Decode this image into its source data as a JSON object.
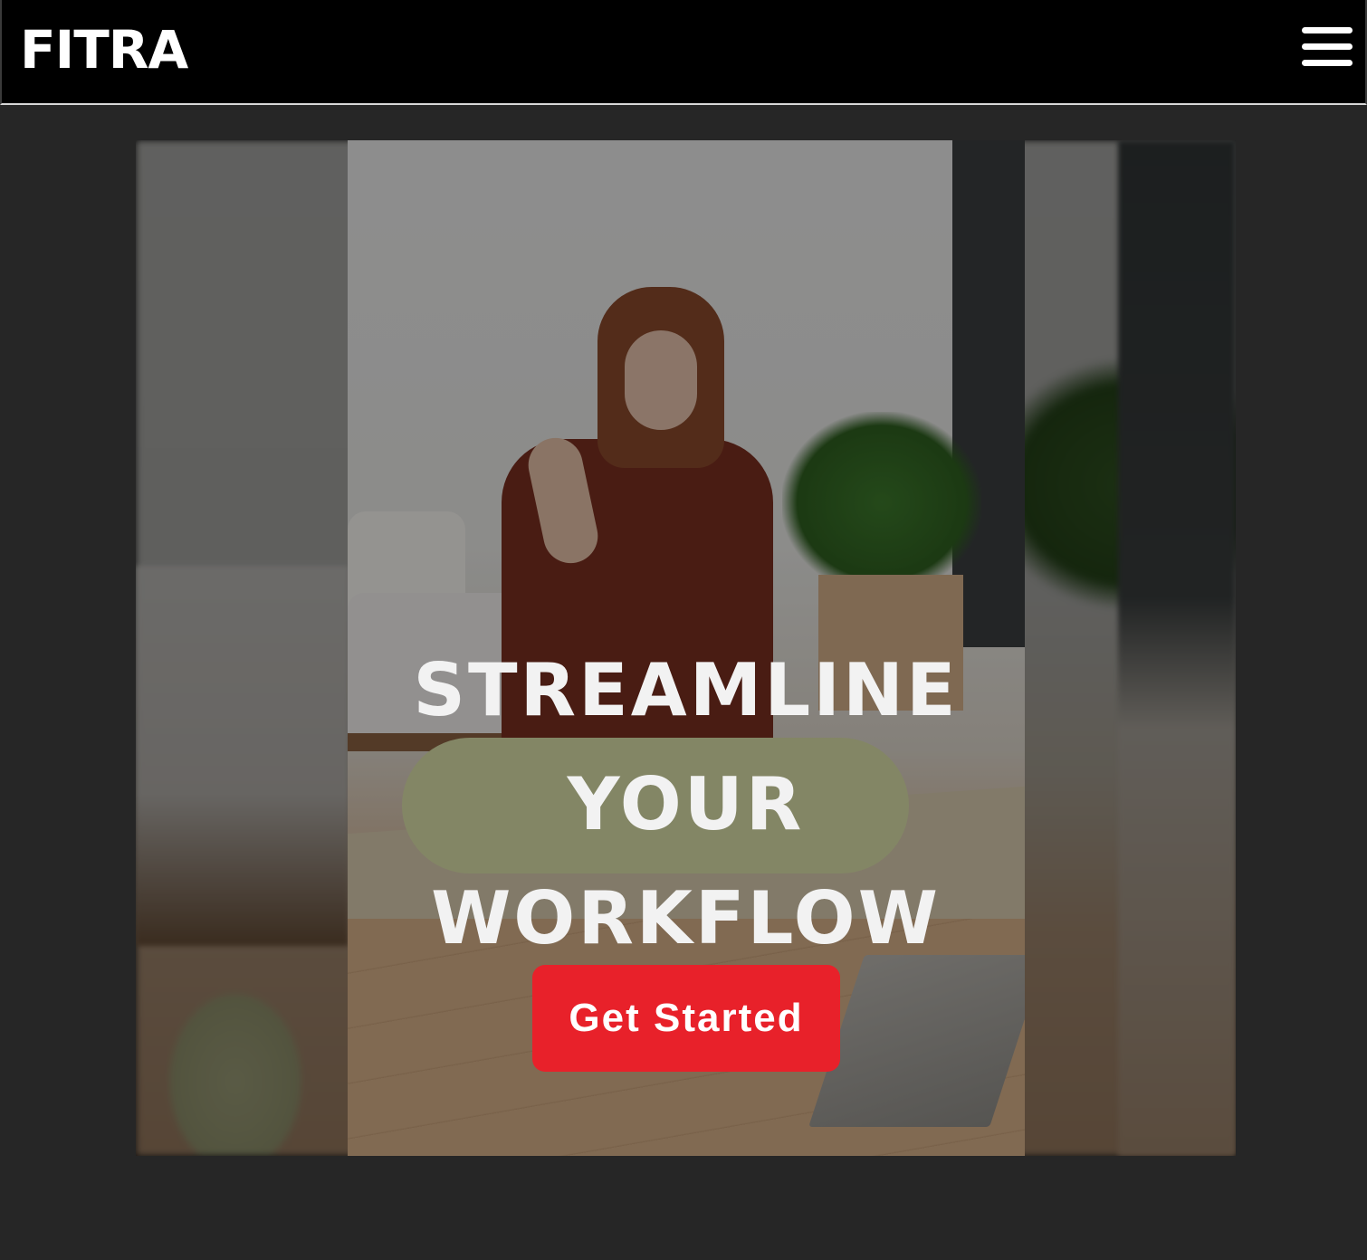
{
  "navbar": {
    "brand": "FITRA",
    "menu_icon": "hamburger-menu-icon"
  },
  "hero": {
    "headline_lines": [
      "STREAMLINE",
      "YOUR",
      "WORKFLOW"
    ],
    "cta_label": "Get Started",
    "cta_color": "#e8212a"
  },
  "colors": {
    "page_background": "#262626",
    "navbar_background": "#000000",
    "text_primary": "#ffffff"
  }
}
